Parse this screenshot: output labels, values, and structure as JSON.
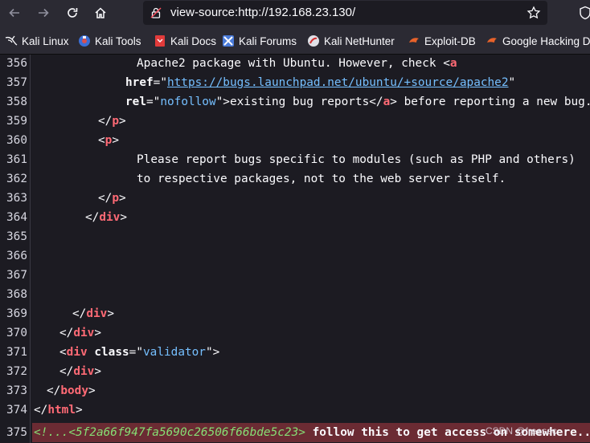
{
  "toolbar": {
    "url": "view-source:http://192.168.23.130/"
  },
  "bookmarks": [
    {
      "label": "Kali Linux",
      "icon": "kali-dragon-icon"
    },
    {
      "label": "Kali Tools",
      "icon": "kali-tools-icon"
    },
    {
      "label": "Kali Docs",
      "icon": "kali-docs-icon"
    },
    {
      "label": "Kali Forums",
      "icon": "kali-forums-icon"
    },
    {
      "label": "Kali NetHunter",
      "icon": "kali-nethunter-icon"
    },
    {
      "label": "Exploit-DB",
      "icon": "exploit-db-icon"
    },
    {
      "label": "Google Hacking D",
      "icon": "ghdb-icon"
    }
  ],
  "source": {
    "line_numbers": [
      "356",
      "357",
      "358",
      "359",
      "360",
      "361",
      "362",
      "363",
      "364",
      "365",
      "366",
      "367",
      "368",
      "369",
      "370",
      "371",
      "372",
      "373",
      "374",
      "375"
    ],
    "text": {
      "l356": "Apache2 package with Ubuntu. However, check <",
      "l357_href_url": "https://bugs.launchpad.net/ubuntu/+source/apache2",
      "l358_rel_val": "nofollow",
      "l358_text": "existing bug reports",
      "l358_after": "> before reporting a new bug.",
      "l361": "Please report bugs specific to modules (such as PHP and others)",
      "l362": "to respective packages, not to the web server itself.",
      "l371_class_val": "validator",
      "l375_comment": "<!...<5f2a66f947fa5690c26506f66bde5c23>",
      "l375_text": " follow this to get access on somewhere.....-->"
    },
    "tags": {
      "a": "a",
      "p": "p",
      "div": "div",
      "body": "body",
      "html": "html"
    },
    "attrs": {
      "href": "href",
      "rel": "rel",
      "class": "class"
    },
    "watermark": "CSDN @freesec"
  },
  "colors": {
    "tag": "#ff6a75",
    "attr_value": "#75bfff",
    "comment": "#86de74",
    "comment_row_bg": "#6b2b33",
    "background": "#1c1b22",
    "toolbar": "#2b2a33"
  }
}
